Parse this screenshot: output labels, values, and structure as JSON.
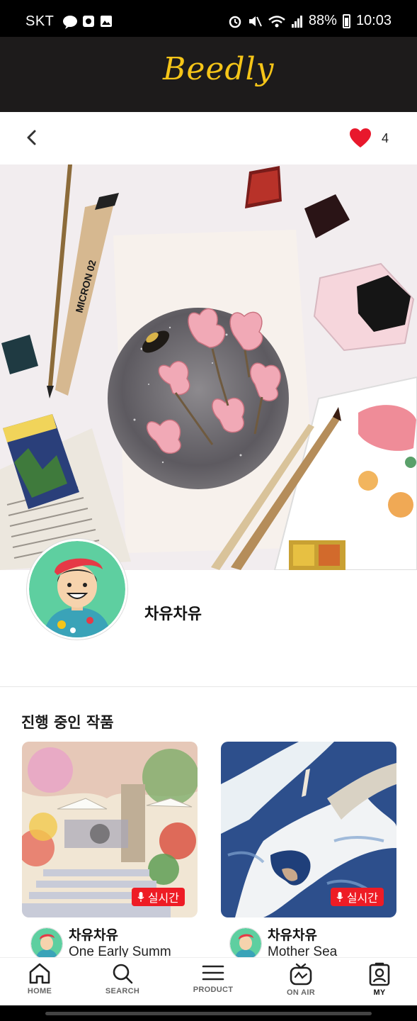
{
  "status_bar": {
    "carrier": "SKT",
    "battery": "88%",
    "time": "10:03"
  },
  "app": {
    "brand": "Beedly"
  },
  "sub_header": {
    "like_count": "4"
  },
  "profile": {
    "name": "차유차유"
  },
  "works_section": {
    "title": "진행 중인 작품",
    "items": [
      {
        "artist": "차유차유",
        "title": "One Early Summ",
        "badge": "실시간"
      },
      {
        "artist": "차유차유",
        "title": "Mother Sea",
        "badge": "실시간"
      }
    ]
  },
  "bottom_nav": {
    "items": [
      {
        "label": "HOME",
        "icon": "home-icon"
      },
      {
        "label": "SEARCH",
        "icon": "search-icon"
      },
      {
        "label": "PRODUCT",
        "icon": "menu-icon"
      },
      {
        "label": "ON AIR",
        "icon": "tv-icon"
      },
      {
        "label": "MY",
        "icon": "profile-icon"
      }
    ]
  },
  "colors": {
    "header_bg": "#1d1b1b",
    "brand": "#f5c518",
    "live": "#ee1c25",
    "heart": "#e8182c"
  }
}
